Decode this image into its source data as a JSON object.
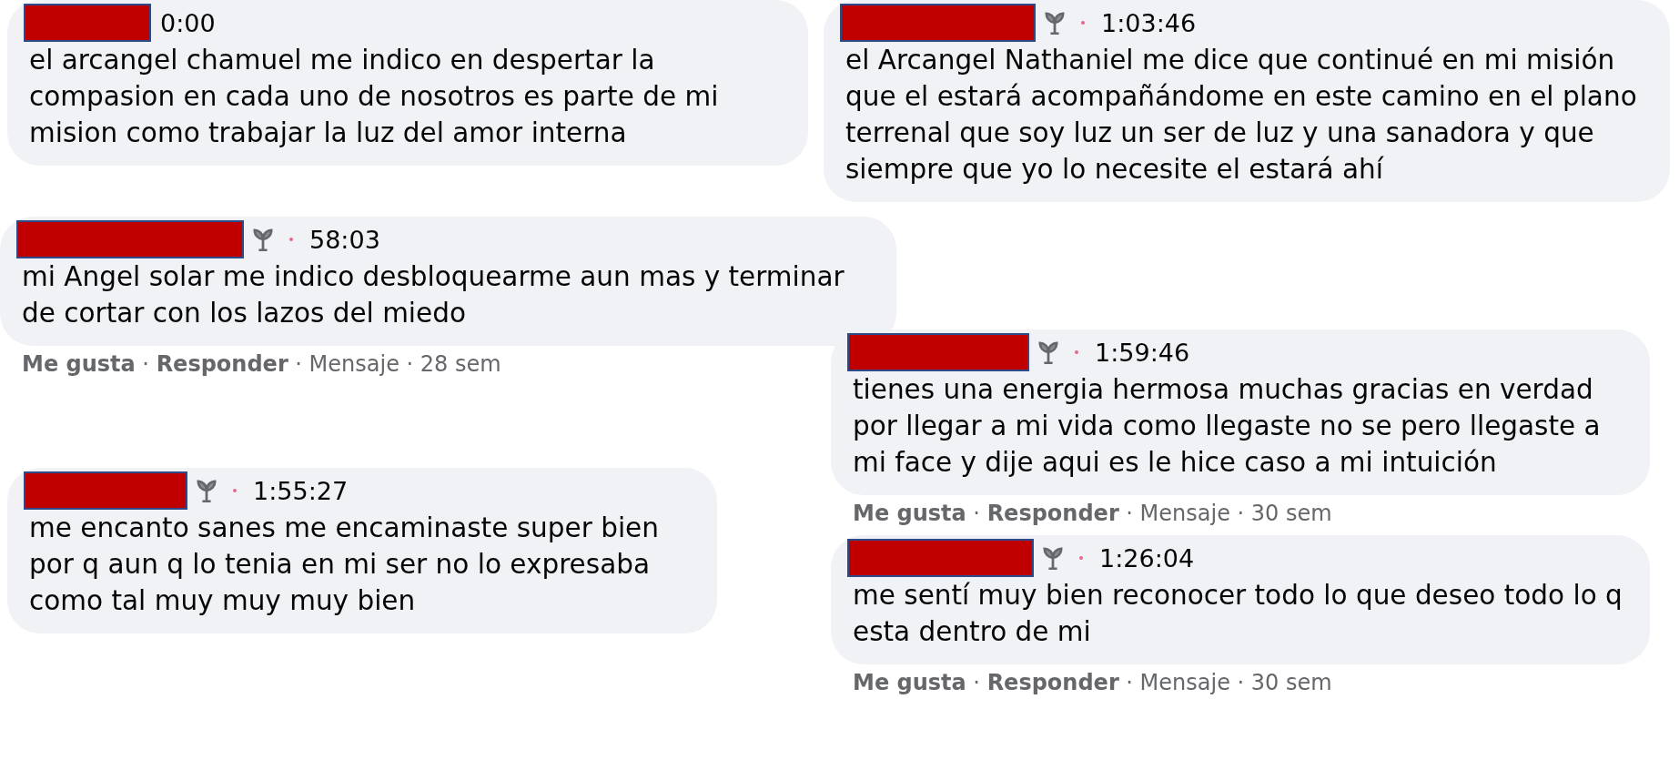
{
  "columns": [
    {
      "comments": [
        {
          "badge": false,
          "time": "0:00",
          "text": "el arcangel chamuel me indico en despertar la compasion en cada uno de nosotros es parte de mi mision como trabajar la luz del amor interna"
        },
        {
          "badge": true,
          "time": "58:03",
          "text": "mi Angel solar me indico desbloquearme aun mas y terminar de cortar con los lazos del miedo",
          "actions": "**Me gusta** · **Responder** · Mensaje · 28 sem"
        },
        {
          "badge": true,
          "time": "1:55:27",
          "text": "me encanto sanes me encaminaste super bien por q aun q lo tenia en mi ser no lo expresaba como tal muy muy muy bien"
        }
      ]
    },
    {
      "comments": [
        {
          "badge": true,
          "time": "1:03:46",
          "text": "el Arcangel Nathaniel me dice que continué en mi misión que el estará acompañándome en este camino en el plano terrenal que soy luz un ser de luz y una sanadora y que siempre que yo lo necesite el estará ahí"
        },
        {
          "badge": true,
          "time": "1:59:46",
          "text": "tienes una energia hermosa muchas gracias en verdad por llegar a mi vida como llegaste no se pero llegaste a mi face y dije aqui es le hice caso a mi intuición",
          "actions": "**Me gusta** · **Responder** · Mensaje · 30 sem"
        },
        {
          "badge": true,
          "time": "1:26:04",
          "text": "me sentí muy bien reconocer todo lo que deseo todo lo q esta dentro de mi",
          "actions": "**Me gusta** · **Responder** · Mensaje · 30 sem"
        }
      ]
    }
  ]
}
